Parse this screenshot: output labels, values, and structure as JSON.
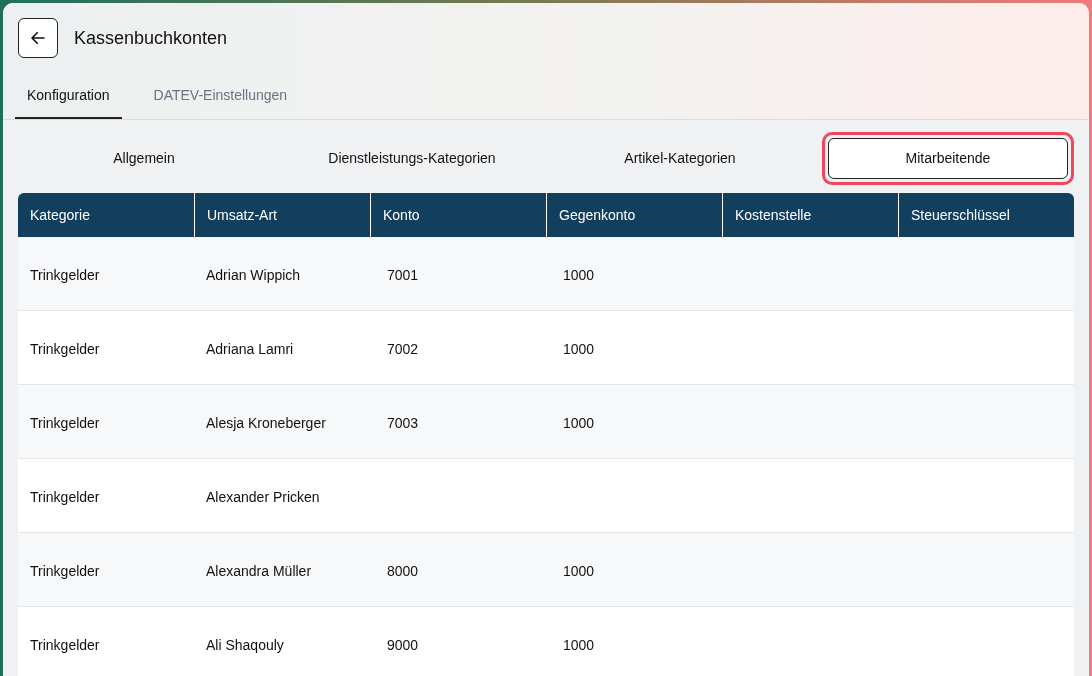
{
  "header": {
    "title": "Kassenbuchkonten"
  },
  "tabs": [
    {
      "label": "Konfiguration",
      "selected": true
    },
    {
      "label": "DATEV-Einstellungen",
      "selected": false
    }
  ],
  "subtabs": [
    {
      "label": "Allgemein",
      "selected": false
    },
    {
      "label": "Dienstleistungs-Kategorien",
      "selected": false
    },
    {
      "label": "Artikel-Kategorien",
      "selected": false
    },
    {
      "label": "Mitarbeitende",
      "selected": true
    }
  ],
  "table": {
    "columns": [
      "Kategorie",
      "Umsatz-Art",
      "Konto",
      "Gegenkonto",
      "Kostenstelle",
      "Steuerschlüssel"
    ],
    "rows": [
      [
        "Trinkgelder",
        "Adrian Wippich",
        "7001",
        "1000",
        "",
        ""
      ],
      [
        "Trinkgelder",
        "Adriana Lamri",
        "7002",
        "1000",
        "",
        ""
      ],
      [
        "Trinkgelder",
        "Alesja Kroneberger",
        "7003",
        "1000",
        "",
        ""
      ],
      [
        "Trinkgelder",
        "Alexander Pricken",
        "",
        "",
        "",
        ""
      ],
      [
        "Trinkgelder",
        "Alexandra Müller",
        "8000",
        "1000",
        "",
        ""
      ],
      [
        "Trinkgelder",
        "Ali Shaqouly",
        "9000",
        "1000",
        "",
        ""
      ]
    ]
  }
}
